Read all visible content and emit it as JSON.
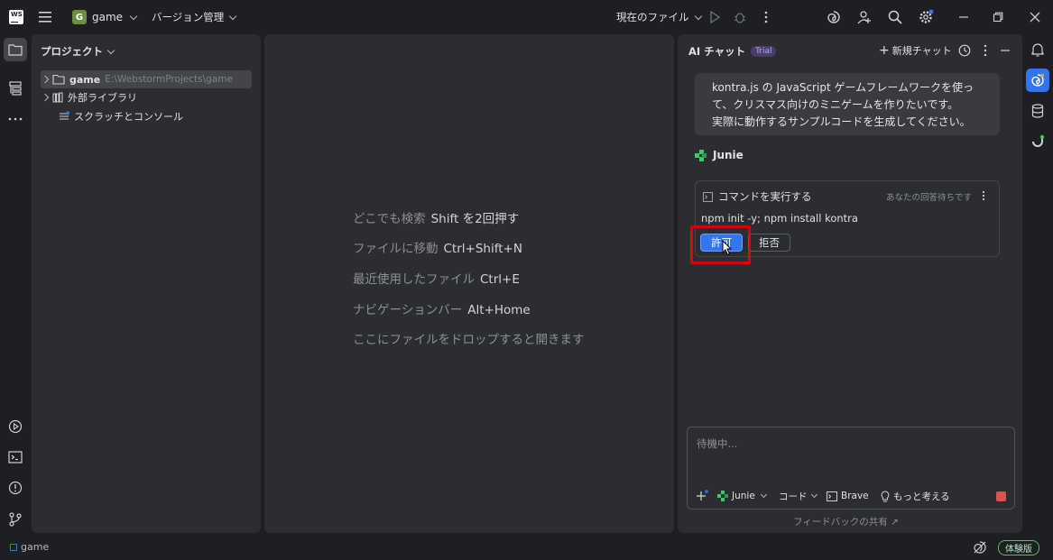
{
  "titlebar": {
    "logo_text": "WS",
    "project_badge": "G",
    "project_name": "game",
    "vcs_label": "バージョン管理",
    "run_config": "現在のファイル"
  },
  "project_panel": {
    "header": "プロジェクト",
    "tree": [
      {
        "label": "game",
        "path": "E:\\WebstormProjects\\game"
      },
      {
        "label": "外部ライブラリ"
      },
      {
        "label": "スクラッチとコンソール"
      }
    ]
  },
  "editor": {
    "hints": [
      {
        "text": "どこでも検索",
        "key": "Shift を2回押す"
      },
      {
        "text": "ファイルに移動",
        "key": "Ctrl+Shift+N"
      },
      {
        "text": "最近使用したファイル",
        "key": "Ctrl+E"
      },
      {
        "text": "ナビゲーションバー",
        "key": "Alt+Home"
      },
      {
        "text": "ここにファイルをドロップすると開きます",
        "key": ""
      }
    ]
  },
  "ai_chat": {
    "title": "AI チャット",
    "badge": "Trial",
    "new_chat": "新規チャット",
    "user_message": [
      "kontra.js の JavaScript ゲームフレームワークを使っ",
      "て、クリスマス向けのミニゲームを作りたいです。",
      "実際に動作するサンプルコードを生成してください。"
    ],
    "agent_name": "Junie",
    "command_card": {
      "title": "コマンドを実行する",
      "status": "あなたの回答待ちです",
      "command": "npm init -y; npm install kontra",
      "allow": "許可",
      "deny": "拒否"
    },
    "input": {
      "placeholder": "待機中...",
      "agent": "Junie",
      "mode": "コード",
      "browser": "Brave",
      "think": "もっと考える"
    },
    "feedback": "フィードバックの共有 ↗"
  },
  "statusbar": {
    "project": "game",
    "edition": "体験版"
  },
  "colors": {
    "accent": "#3574f0",
    "highlight": "#e00000",
    "junie": "#3ec76b"
  }
}
